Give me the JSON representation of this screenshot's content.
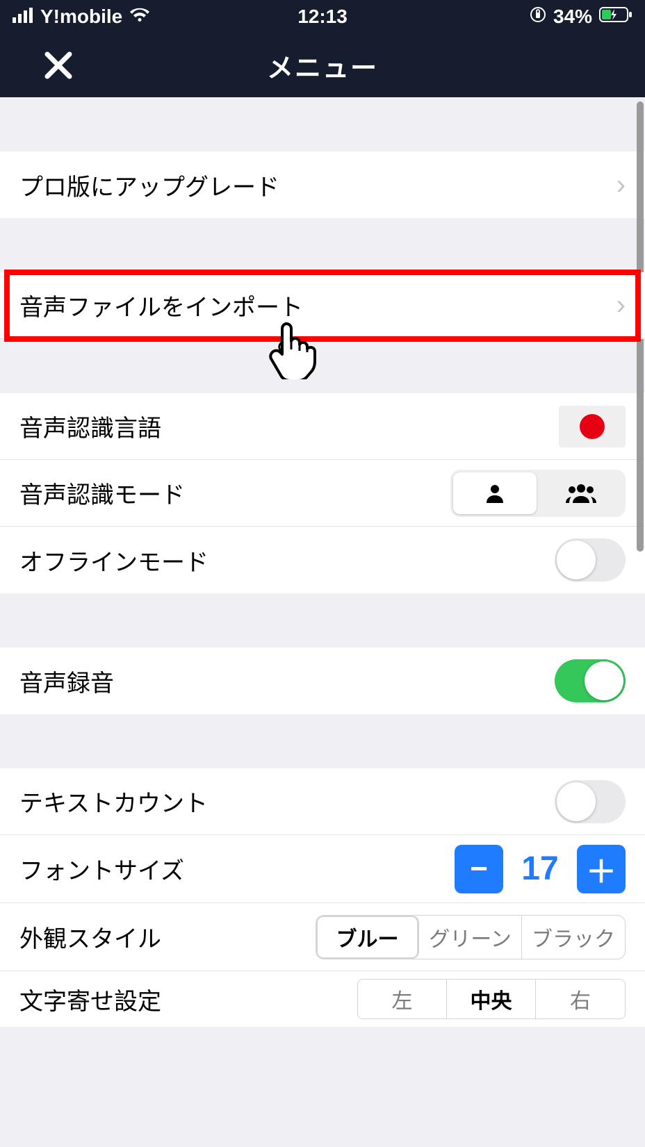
{
  "statusbar": {
    "carrier": "Y!mobile",
    "time": "12:13",
    "battery_percent": "34%"
  },
  "header": {
    "title": "メニュー"
  },
  "rows": {
    "upgrade_pro": "プロ版にアップグレード",
    "import_audio": "音声ファイルをインポート",
    "recognition_language": "音声認識言語",
    "recognition_mode": "音声認識モード",
    "offline_mode": "オフラインモード",
    "audio_recording": "音声録音",
    "text_count": "テキストカウント",
    "font_size": "フォントサイズ",
    "appearance_style": "外観スタイル",
    "text_alignment": "文字寄せ設定"
  },
  "values": {
    "recognition_language_flag": "japan",
    "recognition_mode_selected": "single",
    "offline_mode_on": false,
    "audio_recording_on": true,
    "text_count_on": false,
    "font_size_value": "17",
    "appearance_style_selected": "blue",
    "text_alignment_selected": "center"
  },
  "labels": {
    "stepper_minus": "−",
    "stepper_plus": "＋",
    "style_blue": "ブルー",
    "style_green": "グリーン",
    "style_black": "ブラック",
    "align_left": "左",
    "align_center": "中央",
    "align_right": "右"
  }
}
